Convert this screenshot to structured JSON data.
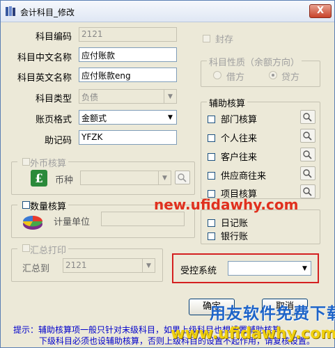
{
  "window": {
    "title": "会计科目_修改",
    "close_label": "X"
  },
  "form": {
    "code_label": "科目编码",
    "code_value": "2121",
    "cn_name_label": "科目中文名称",
    "cn_name_value": "应付账款",
    "en_name_label": "科目英文名称",
    "en_name_value": "应付账款eng",
    "type_label": "科目类型",
    "type_value": "负债",
    "format_label": "账页格式",
    "format_value": "金额式",
    "mnemonic_label": "助记码",
    "mnemonic_value": "YFZK"
  },
  "seal": {
    "label": "封存"
  },
  "nature": {
    "title": "科目性质（余额方向）",
    "debit": "借方",
    "credit": "贷方",
    "selected": "credit"
  },
  "aux": {
    "title": "辅助核算",
    "items": [
      {
        "label": "部门核算"
      },
      {
        "label": "个人往来"
      },
      {
        "label": "客户往来"
      },
      {
        "label": "供应商往来"
      },
      {
        "label": "项目核算"
      }
    ]
  },
  "journal": {
    "daily": "日记账",
    "bank": "银行账"
  },
  "foreign": {
    "title": "外币核算",
    "currency_label": "币种",
    "currency_value": ""
  },
  "qty": {
    "title": "数量核算",
    "unit_label": "计量单位",
    "unit_value": ""
  },
  "summary": {
    "title": "汇总打印",
    "to_label": "汇总到",
    "to_value": "2121"
  },
  "control": {
    "label": "受控系统",
    "value": ""
  },
  "buttons": {
    "ok": "确定",
    "cancel": "取消"
  },
  "hint": {
    "line1": "提示：辅助核算项一般只针对末级科目，如果上级科目也想设置辅助核算，",
    "line2": "下级科目必须也设辅助核算，否则上级科目的设置不起作用，请复核设置。"
  },
  "watermarks": {
    "center": "new.ufidawhy.com",
    "brand": "用友软件免费下载",
    "bottom": "www.ufidawhy.com"
  }
}
